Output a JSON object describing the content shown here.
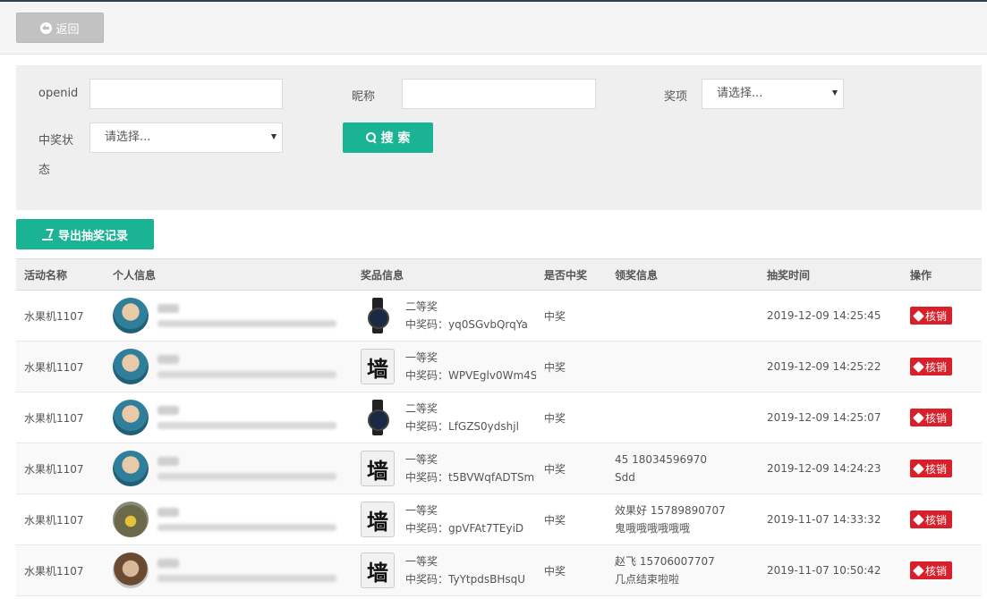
{
  "header": {
    "back_label": "返回"
  },
  "search": {
    "openid_label": "openid",
    "nickname_label": "昵称",
    "prize_label": "奖项",
    "prize_select": "请选择...",
    "status_label_1": "中奖状",
    "status_label_2": "态",
    "status_select": "请选择...",
    "search_button": "搜 索"
  },
  "export_button": "导出抽奖记录",
  "table": {
    "columns": [
      "活动名称",
      "个人信息",
      "奖品信息",
      "是否中奖",
      "领奖信息",
      "抽奖时间",
      "操作"
    ],
    "verify_label": "核销",
    "rows": [
      {
        "activity": "水果机1107",
        "avatar": "baby",
        "prize_img": "watch",
        "prize_name": "二等奖",
        "code": "中奖码：yq0SGvbQrqYa",
        "won": "中奖",
        "claim1": "",
        "claim2": "",
        "time": "2019-12-09 14:25:45"
      },
      {
        "activity": "水果机1107",
        "avatar": "baby",
        "prize_img": "wall",
        "prize_name": "一等奖",
        "code": "中奖码：WPVEglv0Wm4S",
        "won": "中奖",
        "claim1": "",
        "claim2": "",
        "time": "2019-12-09 14:25:22"
      },
      {
        "activity": "水果机1107",
        "avatar": "baby",
        "prize_img": "watch",
        "prize_name": "二等奖",
        "code": "中奖码：LfGZS0ydshjl",
        "won": "中奖",
        "claim1": "",
        "claim2": "",
        "time": "2019-12-09 14:25:07"
      },
      {
        "activity": "水果机1107",
        "avatar": "baby",
        "prize_img": "wall",
        "prize_name": "一等奖",
        "code": "中奖码：t5BVWqfADTSm",
        "won": "中奖",
        "claim1": "45   18034596970",
        "claim2": "Sdd",
        "time": "2019-12-09 14:24:23"
      },
      {
        "activity": "水果机1107",
        "avatar": "food",
        "prize_img": "wall",
        "prize_name": "一等奖",
        "code": "中奖码：gpVFAt7TEyiD",
        "won": "中奖",
        "claim1": "效果好   15789890707",
        "claim2": "鬼哦哦哦哦哦哦",
        "time": "2019-11-07 14:33:32"
      },
      {
        "activity": "水果机1107",
        "avatar": "face",
        "prize_img": "wall",
        "prize_name": "一等奖",
        "code": "中奖码：TyYtpdsBHsqU",
        "won": "中奖",
        "claim1": "赵飞   15706007707",
        "claim2": "几点结束啦啦",
        "time": "2019-11-07 10:50:42"
      }
    ]
  },
  "wall_char": "墙"
}
